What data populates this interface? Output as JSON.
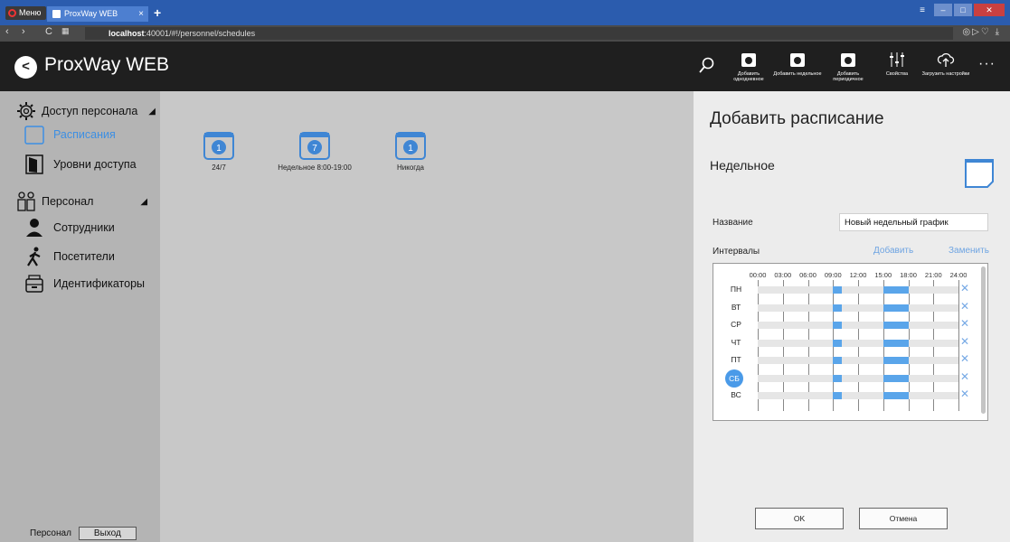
{
  "browser": {
    "menu_label": "Меню",
    "tab_title": "ProxWay WEB",
    "tab_close": "×",
    "new_tab": "+",
    "url_prefix": "localhost",
    "url_rest": ":40001/#!/personnel/schedules"
  },
  "header": {
    "title": "ProxWay WEB",
    "toolbar": [
      {
        "label": "Добавить однодневное",
        "icon": "calendar-1-icon"
      },
      {
        "label": "Добавить недельное",
        "icon": "calendar-7-icon"
      },
      {
        "label": "Добавить периодичное",
        "icon": "calendar-period-icon"
      },
      {
        "label": "Свойства",
        "icon": "sliders-icon"
      },
      {
        "label": "Загрузить настройки",
        "icon": "cloud-upload-icon"
      }
    ]
  },
  "sidebar": {
    "groups": [
      {
        "label": "Доступ персонала",
        "items": [
          {
            "label": "Расписания",
            "active": true
          },
          {
            "label": "Уровни доступа"
          }
        ]
      },
      {
        "label": "Персонал",
        "items": [
          {
            "label": "Сотрудники"
          },
          {
            "label": "Посетители"
          },
          {
            "label": "Идентификаторы"
          }
        ]
      }
    ],
    "footer_label": "Персонал",
    "logout_label": "Выход"
  },
  "schedules": [
    {
      "label": "24/7",
      "badge": "1"
    },
    {
      "label": "Недельное 8:00-19:00",
      "badge": "7"
    },
    {
      "label": "Никогда",
      "badge": "1"
    }
  ],
  "panel": {
    "title": "Добавить расписание",
    "subtitle": "Недельное",
    "name_label": "Название",
    "name_value": "Новый недельный график",
    "intervals_label": "Интервалы",
    "add_link": "Добавить",
    "replace_link": "Заменить",
    "hours": [
      "00:00",
      "03:00",
      "06:00",
      "09:00",
      "12:00",
      "15:00",
      "18:00",
      "21:00",
      "24:00"
    ],
    "days": [
      "ПН",
      "ВТ",
      "СР",
      "ЧТ",
      "ПТ",
      "СБ",
      "ВС"
    ],
    "selected_day": "СБ",
    "intervals": [
      [
        9.0,
        10.0
      ],
      [
        15.0,
        18.0
      ]
    ],
    "remove_glyph": "✕",
    "ok_label": "OK",
    "cancel_label": "Отмена"
  },
  "colors": {
    "accent": "#4a9ae8",
    "interval": "#5aa5ea",
    "header_bg": "#1f1f1f"
  }
}
